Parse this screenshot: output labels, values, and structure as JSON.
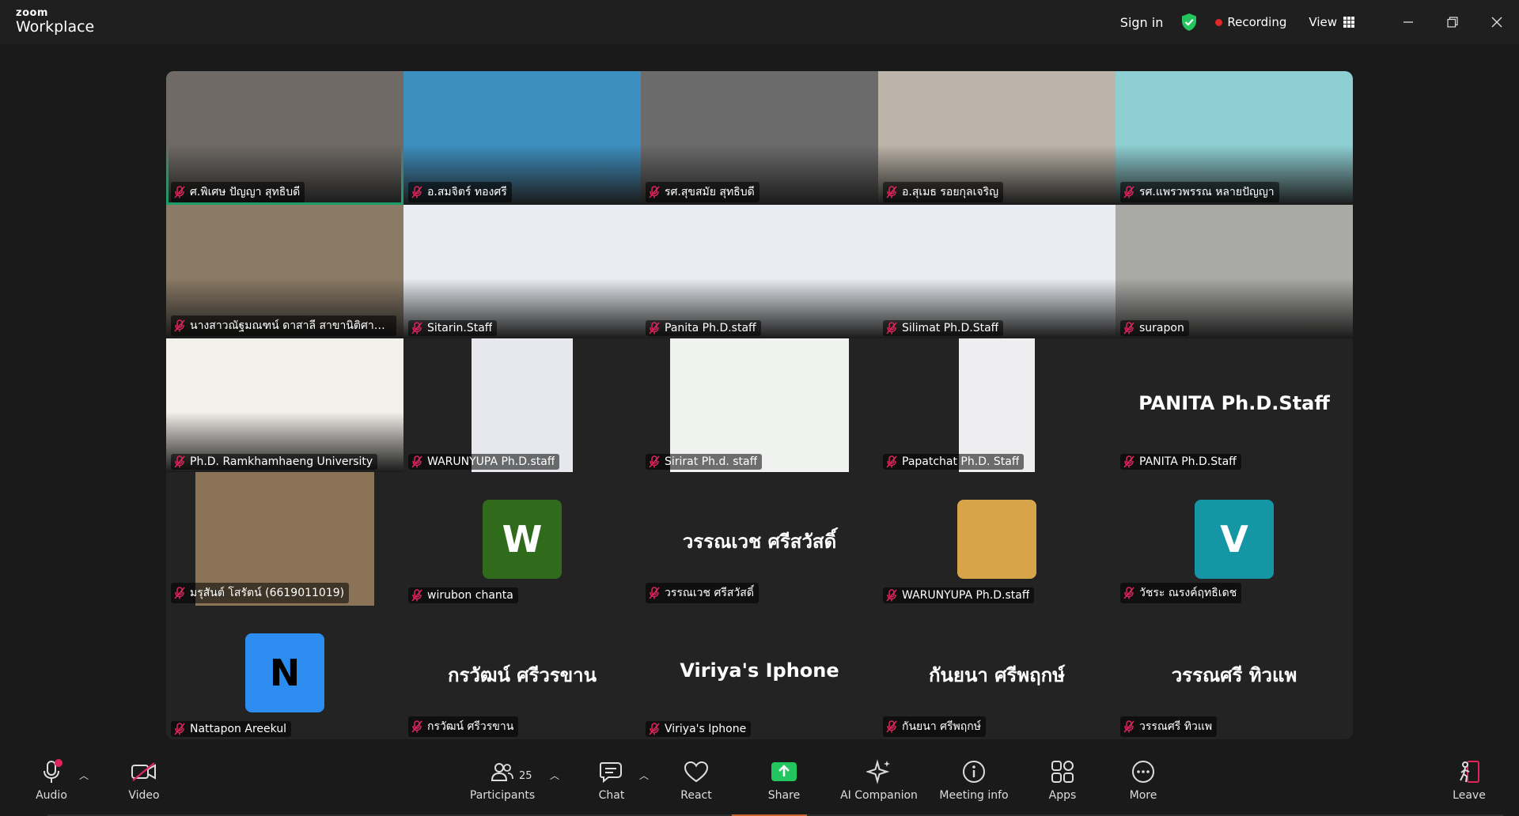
{
  "app": {
    "brand_top": "zoom",
    "brand_bottom": "Workplace"
  },
  "titlebar": {
    "signin": "Sign in",
    "recording": "Recording",
    "view": "View"
  },
  "tiles": [
    {
      "name": "ศ.พิเศษ ปัญญา สุทธิบดี",
      "kind": "video",
      "bg": "#6f6a66",
      "active": true
    },
    {
      "name": "อ.สมจิตร์ ทองศรี",
      "kind": "video",
      "bg": "#3d8fbf"
    },
    {
      "name": "รศ.สุขสมัย สุทธิบดี",
      "kind": "video",
      "bg": "#6b6b6b"
    },
    {
      "name": "อ.สุเมธ รอยกุลเจริญ",
      "kind": "video",
      "bg": "#bcb4a8"
    },
    {
      "name": "รศ.แพรวพรรณ หลายปัญญา",
      "kind": "video",
      "bg": "#8ecfd3"
    },
    {
      "name": "นางสาวณัฐมณฑน์ ดาสาลี สาขานิติศาสตร์",
      "kind": "video",
      "bg": "#8a7a66"
    },
    {
      "name": "Sitarin.Staff",
      "kind": "video",
      "bg": "#e9ecf2"
    },
    {
      "name": "Panita Ph.D.staff",
      "kind": "video",
      "bg": "#e9ecf2"
    },
    {
      "name": "Silimat Ph.D.Staff",
      "kind": "video",
      "bg": "#e9ecf2"
    },
    {
      "name": "surapon",
      "kind": "video",
      "bg": "#a9a9a6"
    },
    {
      "name": "Ph.D. Ramkhamhaeng University",
      "kind": "video",
      "bg": "#f2f0ea"
    },
    {
      "name": "WARUNYUPA Ph.D.staff",
      "kind": "video-inset",
      "bg": "#e6e8ee",
      "w": 128
    },
    {
      "name": "Sirirat Ph.d. staff",
      "kind": "video-inset",
      "bg": "#f0f2f0",
      "w": 226
    },
    {
      "name": "Papatchat Ph.D. Staff",
      "kind": "video-inset",
      "bg": "#eeeef0",
      "w": 96
    },
    {
      "name": "PANITA Ph.D.Staff",
      "kind": "text",
      "big": "PANITA Ph.D.Staff"
    },
    {
      "name": "มรุสันต์ โสรัตน์ (6619011019)",
      "kind": "video-inset",
      "bg": "#8b7358",
      "w": 226
    },
    {
      "name": "wirubon chanta",
      "kind": "avatar",
      "letter": "W",
      "color": "#2f6b1a"
    },
    {
      "name": "วรรณเวช ศรีสวัสดิ์",
      "kind": "text",
      "big": "วรรณเวช ศรีสวัสดิ์"
    },
    {
      "name": "WARUNYUPA Ph.D.staff",
      "kind": "avatar-photo",
      "color": "#d7a44a"
    },
    {
      "name": "วัชระ ณรงค์ฤทธิเดช",
      "kind": "avatar",
      "letter": "V",
      "color": "#1596a5"
    },
    {
      "name": "Nattapon Areekul",
      "kind": "avatar",
      "letter": "N",
      "color": "#2d8cf0",
      "dark": true
    },
    {
      "name": "กรวัฒน์ ศรีวรขาน",
      "kind": "text",
      "big": "กรวัฒน์ ศรีวรขาน"
    },
    {
      "name": "Viriya's Iphone",
      "kind": "text",
      "big": "Viriya's Iphone"
    },
    {
      "name": "กันยนา ศรีพฤกษ์",
      "kind": "text",
      "big": "กันยนา ศรีพฤกษ์"
    },
    {
      "name": "วรรณศรี ทิวแพ",
      "kind": "text",
      "big": "วรรณศรี  ทิวแพ"
    }
  ],
  "toolbar": {
    "audio": "Audio",
    "video": "Video",
    "participants": "Participants",
    "participants_count": "25",
    "chat": "Chat",
    "react": "React",
    "share": "Share",
    "ai": "AI Companion",
    "info": "Meeting info",
    "apps": "Apps",
    "more": "More",
    "leave": "Leave"
  }
}
